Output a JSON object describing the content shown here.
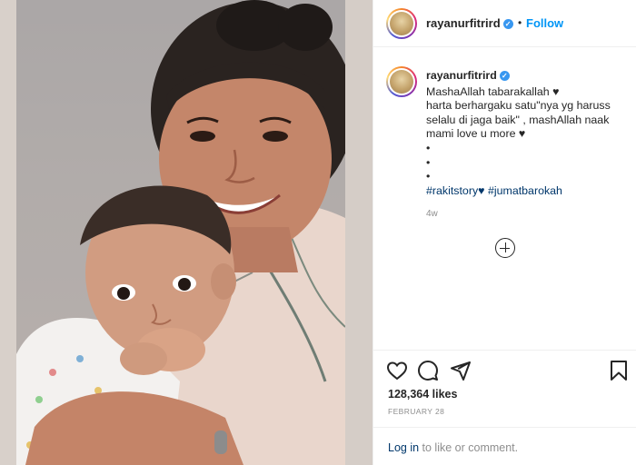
{
  "post": {
    "username": "rayanurfitrird",
    "verified_mark": "✓",
    "dot": "•",
    "follow_label": "Follow"
  },
  "caption": {
    "username": "rayanurfitrird",
    "lines": [
      "MashaAllah tabarakallah ♥",
      "harta berhargaku satu\"nya yg haruss",
      "selalu di jaga baik\" , mashAllah naak",
      "mami love u more ♥",
      "•",
      "•",
      "•"
    ],
    "hashtag1": "#rakitstory♥",
    "hashtag2": "#jumatbarokah",
    "time_ago": "4w"
  },
  "stats": {
    "likes": "128,364 likes",
    "date": "FEBRUARY 28"
  },
  "login": {
    "link": "Log in",
    "rest": " to like or comment."
  },
  "icons": {
    "like": "heart-icon",
    "comment": "comment-icon",
    "share": "share-icon",
    "save": "bookmark-icon",
    "load_more": "plus-circle-icon"
  },
  "colors": {
    "accent": "#0095f6",
    "hashtag": "#00376b",
    "muted": "#8e8e8e"
  }
}
